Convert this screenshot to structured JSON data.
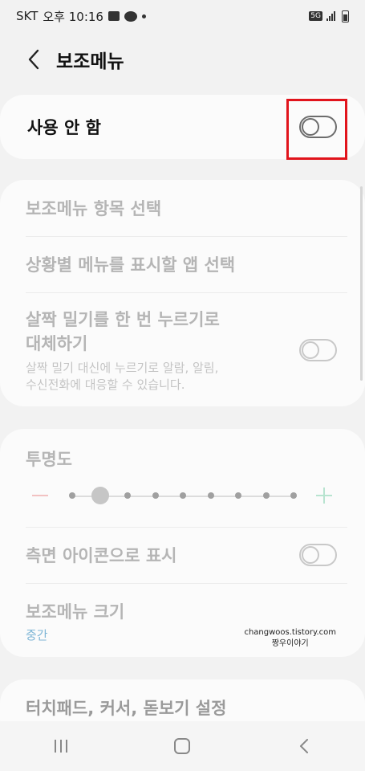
{
  "status_bar": {
    "carrier": "SKT",
    "time": "오후 10:16",
    "network": "5G",
    "icons": [
      "message-icon",
      "kakaotalk-icon",
      "notification-dot-icon",
      "5g-icon",
      "signal-icon",
      "battery-icon"
    ]
  },
  "header": {
    "title": "보조메뉴",
    "back_icon": "chevron-left-icon"
  },
  "master_switch": {
    "label": "사용 안 함",
    "state": "off"
  },
  "section_a": {
    "items": [
      {
        "label": "보조메뉴 항목 선택"
      },
      {
        "label": "상황별 메뉴를 표시할 앱 선택"
      },
      {
        "label_line1": "살짝 밀기를 한 번 누르기로",
        "label_line2": "대체하기",
        "sub_line1": "살짝 밀기 대신에 누르기로 알람, 알림,",
        "sub_line2": "수신전화에 대응할 수 있습니다.",
        "toggle_state": "off"
      }
    ]
  },
  "section_b": {
    "transparency": {
      "label": "투명도",
      "steps": 9,
      "selected_step": 2
    },
    "side_icon": {
      "label": "측면 아이콘으로 표시",
      "toggle_state": "off"
    },
    "menu_size": {
      "label": "보조메뉴 크기",
      "value": "중간"
    }
  },
  "watermark": {
    "line1": "changwoos.tistory.com",
    "line2": "짱우이야기"
  },
  "section_c": {
    "label": "터치패드, 커서, 돋보기 설정"
  },
  "nav_bar": {
    "icons": [
      "recents-icon",
      "home-icon",
      "back-icon"
    ]
  },
  "colors": {
    "highlight": "#e1141c",
    "accent_value": "#7fb6d6",
    "disabled_text": "#b5b5b5"
  }
}
